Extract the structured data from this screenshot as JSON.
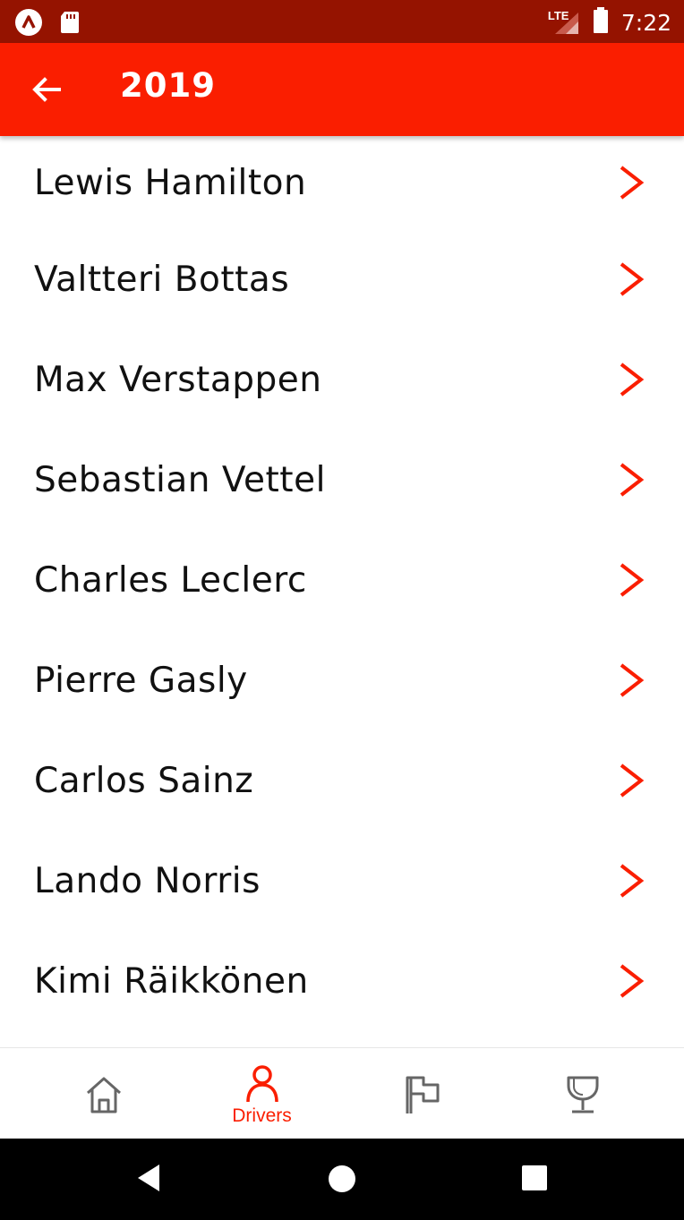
{
  "status_bar": {
    "network": "LTE",
    "time": "7:22"
  },
  "app_bar": {
    "title": "2019",
    "back_icon": "arrow-left-icon"
  },
  "drivers": [
    {
      "name": "Lewis Hamilton"
    },
    {
      "name": "Valtteri Bottas"
    },
    {
      "name": "Max Verstappen"
    },
    {
      "name": "Sebastian Vettel"
    },
    {
      "name": "Charles Leclerc"
    },
    {
      "name": "Pierre Gasly"
    },
    {
      "name": "Carlos Sainz"
    },
    {
      "name": "Lando Norris"
    },
    {
      "name": "Kimi Räikkönen"
    }
  ],
  "bottom_nav": {
    "items": [
      {
        "icon": "home-icon",
        "label": "",
        "active": false
      },
      {
        "icon": "person-icon",
        "label": "Drivers",
        "active": true
      },
      {
        "icon": "flag-icon",
        "label": "",
        "active": false
      },
      {
        "icon": "trophy-icon",
        "label": "",
        "active": false
      }
    ]
  },
  "colors": {
    "status_bar": "#951300",
    "accent": "#fa1e00",
    "inactive_icon": "#666666",
    "system_nav": "#000000"
  }
}
